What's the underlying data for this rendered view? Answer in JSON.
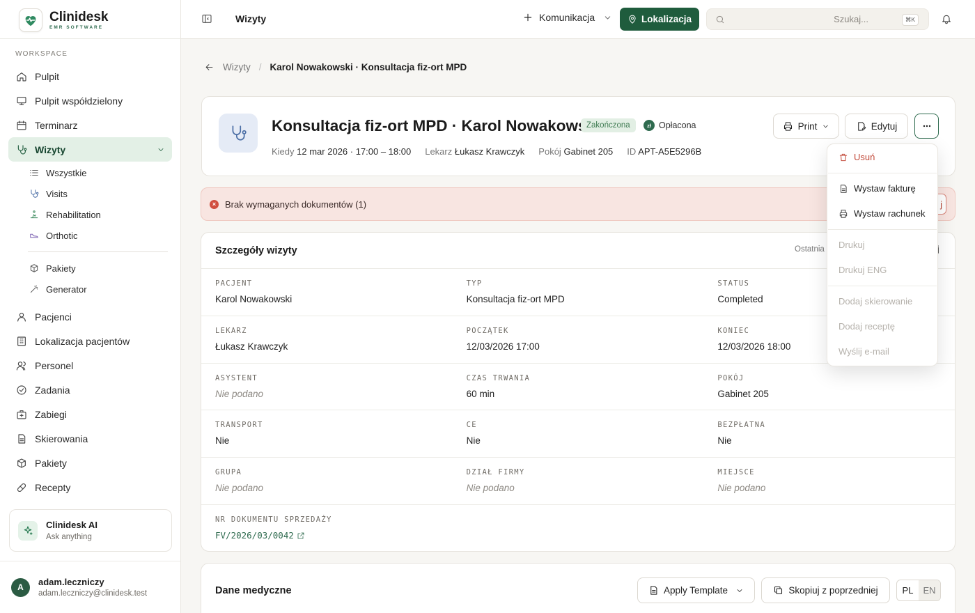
{
  "brand": {
    "name": "Clinidesk",
    "tagline": "EMR SOFTWARE"
  },
  "sidebar": {
    "section": "WORKSPACE",
    "items": [
      {
        "label": "Pulpit",
        "icon": "home-icon"
      },
      {
        "label": "Pulpit współdzielony",
        "icon": "monitor-icon"
      },
      {
        "label": "Terminarz",
        "icon": "calendar-icon"
      },
      {
        "label": "Wizyty",
        "icon": "stethoscope-icon",
        "active": true
      },
      {
        "label": "Pacjenci",
        "icon": "user-icon"
      },
      {
        "label": "Lokalizacja pacjentów",
        "icon": "building-icon"
      },
      {
        "label": "Personel",
        "icon": "users-icon"
      },
      {
        "label": "Zadania",
        "icon": "check-circle-icon"
      },
      {
        "label": "Zabiegi",
        "icon": "bag-icon"
      },
      {
        "label": "Skierowania",
        "icon": "document-icon"
      },
      {
        "label": "Pakiety",
        "icon": "box-icon"
      },
      {
        "label": "Recepty",
        "icon": "pill-icon"
      }
    ],
    "sub_items": [
      {
        "label": "Wszystkie",
        "icon": "list-icon"
      },
      {
        "label": "Visits",
        "icon": "stethoscope-icon"
      },
      {
        "label": "Rehabilitation",
        "icon": "rehab-icon"
      },
      {
        "label": "Orthotic",
        "icon": "shoe-icon"
      },
      {
        "label": "Pakiety",
        "icon": "box-icon"
      },
      {
        "label": "Generator",
        "icon": "wand-icon"
      }
    ],
    "ai": {
      "title": "Clinidesk AI",
      "subtitle": "Ask anything"
    },
    "user": {
      "initial": "A",
      "name": "adam.leczniczy",
      "email": "adam.leczniczy@clinidesk.test"
    }
  },
  "topbar": {
    "title": "Wizyty",
    "komunikacja": "Komunikacja",
    "lokalizacja": "Lokalizacja",
    "search_placeholder": "Szukaj...",
    "shortcut": "⌘K"
  },
  "breadcrumb": {
    "parent": "Wizyty",
    "current": "Karol Nowakowski · Konsultacja fiz-ort MPD"
  },
  "visit": {
    "title": "Konsultacja fiz-ort MPD · Karol Nowakowski",
    "status": "Zakończona",
    "payment_icon": "zł",
    "payment": "Opłacona",
    "meta": [
      {
        "label": "Kiedy",
        "value": "12 mar 2026 · 17:00 – 18:00"
      },
      {
        "label": "Lekarz",
        "value": "Łukasz Krawczyk"
      },
      {
        "label": "Pokój",
        "value": "Gabinet 205"
      },
      {
        "label": "ID",
        "value": "APT-A5E5296B"
      }
    ],
    "print_label": "Print",
    "edit_label": "Edytuj"
  },
  "alert": {
    "text": "Brak wymaganych dokumentów (1)",
    "button_fragment": "j"
  },
  "details": {
    "title": "Szczegóły wizyty",
    "last_label": "Ostatnia",
    "edge_text": "j",
    "rows": [
      [
        {
          "label": "PACJENT",
          "value": "Karol Nowakowski"
        },
        {
          "label": "TYP",
          "value": "Konsultacja fiz-ort MPD"
        },
        {
          "label": "STATUS",
          "value": "Completed"
        }
      ],
      [
        {
          "label": "LEKARZ",
          "value": "Łukasz Krawczyk"
        },
        {
          "label": "POCZĄTEK",
          "value": "12/03/2026 17:00"
        },
        {
          "label": "KONIEC",
          "value": "12/03/2026 18:00"
        }
      ],
      [
        {
          "label": "ASYSTENT",
          "value": "Nie podano",
          "empty": true
        },
        {
          "label": "CZAS TRWANIA",
          "value": "60 min"
        },
        {
          "label": "POKÓJ",
          "value": "Gabinet 205"
        }
      ],
      [
        {
          "label": "TRANSPORT",
          "value": "Nie"
        },
        {
          "label": "CE",
          "value": "Nie"
        },
        {
          "label": "BEZPŁATNA",
          "value": "Nie"
        }
      ],
      [
        {
          "label": "GRUPA",
          "value": "Nie podano",
          "empty": true
        },
        {
          "label": "DZIAŁ FIRMY",
          "value": "Nie podano",
          "empty": true
        },
        {
          "label": "MIEJSCE",
          "value": "Nie podano",
          "empty": true
        }
      ]
    ],
    "doc_label": "NR DOKUMENTU SPRZEDAŻY",
    "doc_value": "FV/2026/03/0042"
  },
  "medical": {
    "title": "Dane medyczne",
    "apply_label": "Apply Template",
    "copy_label": "Skopiuj z poprzedniej",
    "lang_pl": "PL",
    "lang_en": "EN"
  },
  "menu": {
    "delete": "Usuń",
    "invoice": "Wystaw fakturę",
    "bill": "Wystaw rachunek",
    "print": "Drukuj",
    "print_eng": "Drukuj ENG",
    "referral": "Dodaj skierowanie",
    "prescription": "Dodaj receptę",
    "email": "Wyślij e-mail"
  },
  "colors": {
    "accent": "#1f5c3d",
    "active_bg": "#e3f0e6",
    "alert_bg": "#f8e5e1",
    "danger": "#c24a3a"
  }
}
